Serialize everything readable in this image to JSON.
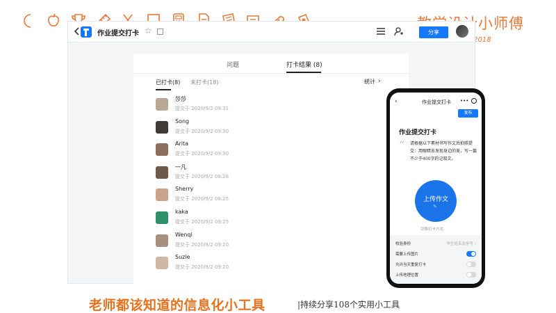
{
  "brand": {
    "name": "教学设计小师傅",
    "since": "since 2018"
  },
  "app": {
    "title": "作业提交打卡",
    "share_label": "分享"
  },
  "tabs": [
    {
      "label": "问题"
    },
    {
      "label": "打卡结果 (8)"
    }
  ],
  "subtabs": {
    "done": "已打卡(8)",
    "pending": "未打卡(18)",
    "stats": "统计"
  },
  "checkins": [
    {
      "name": "莎莎",
      "time": "提交于 2020/9/2 09:31",
      "avatar_color": "#b9a896"
    },
    {
      "name": "Song",
      "time": "提交于 2020/9/2 09:30",
      "avatar_color": "#3f3b36"
    },
    {
      "name": "Arita",
      "time": "提交于 2020/9/2 09:30",
      "avatar_color": "#8c6f5a"
    },
    {
      "name": "一凡",
      "time": "提交于 2020/9/2 09:28",
      "avatar_color": "#6d5a4a"
    },
    {
      "name": "Sherry",
      "time": "提交于 2020/9/2 09:25",
      "avatar_color": "#c9a48a"
    },
    {
      "name": "kaka",
      "time": "提交于 2020/9/2 09:25",
      "avatar_color": "#2f8f6a"
    },
    {
      "name": "Wenqi",
      "time": "提交于 2020/9/2 09:20",
      "avatar_color": "#a89080"
    },
    {
      "name": "Suzie",
      "time": "提交于 2020/9/2 09:20",
      "avatar_color": "#d2b8a4"
    }
  ],
  "phone": {
    "title": "作业提交打卡",
    "more": "•••",
    "publish": "发布",
    "heading": "作业提交打卡",
    "body": "请根据以下素材书写作文后拍照提交：用眼睛去发现身边的美，写一篇不少于400字的记叙文。",
    "upload_label": "上传作文",
    "switch_mode": "切换打卡方式",
    "settings": [
      {
        "label": "校验身份",
        "value": "学生姓名及学号 ›",
        "type": "text"
      },
      {
        "label": "需要上传图片",
        "on": true,
        "type": "toggle"
      },
      {
        "label": "允许当天重复打卡",
        "on": false,
        "type": "toggle"
      },
      {
        "label": "上传地理位置",
        "on": false,
        "type": "toggle"
      }
    ]
  },
  "caption": {
    "main": "老师都该知道的信息化小工具",
    "sub": "|持续分享108个实用小工具"
  },
  "colors": {
    "accent": "#1677ff",
    "brand_orange": "#e87a3a",
    "caption_orange": "#e8711f"
  }
}
